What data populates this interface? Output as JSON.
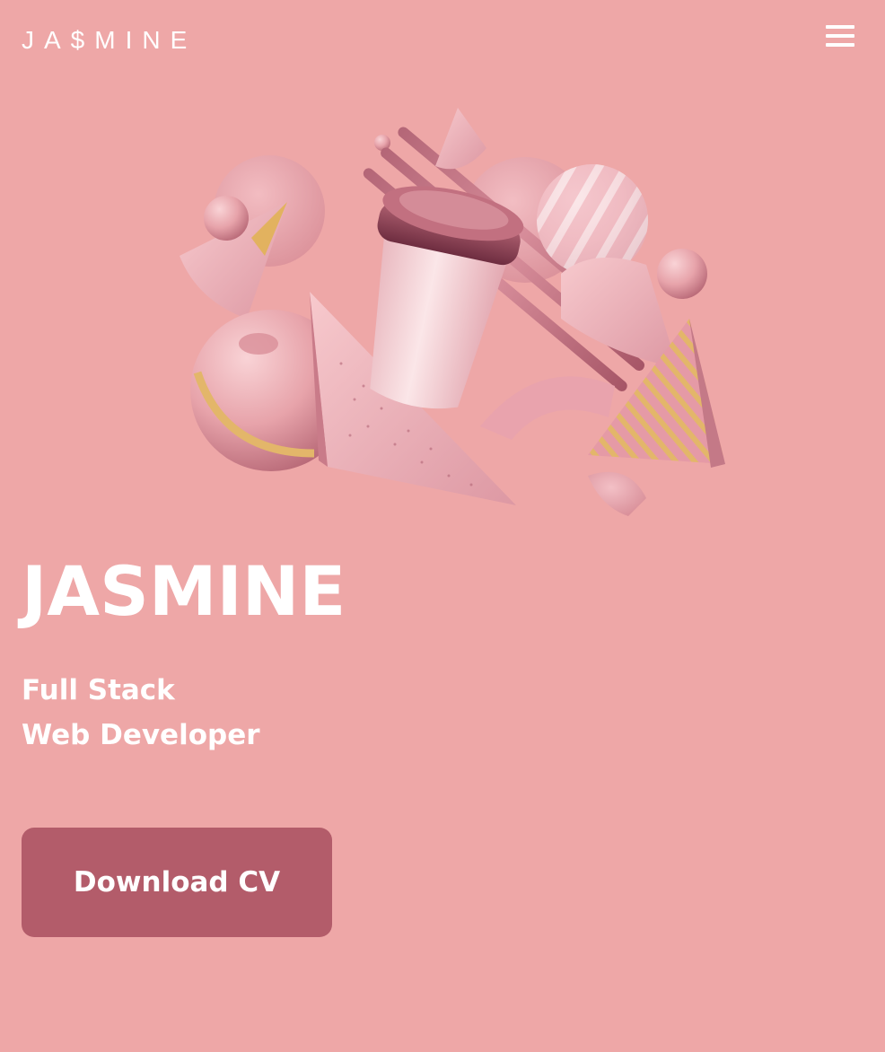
{
  "header": {
    "logo_text": "JA$MINE",
    "menu_icon": "hamburger-menu-icon"
  },
  "hero": {
    "name": "JASMINE",
    "role_line1": "Full Stack",
    "role_line2": "Web Developer",
    "cta_label": "Download CV"
  },
  "colors": {
    "background": "#eea7a7",
    "button": "#b35c6a",
    "text": "#ffffff"
  }
}
